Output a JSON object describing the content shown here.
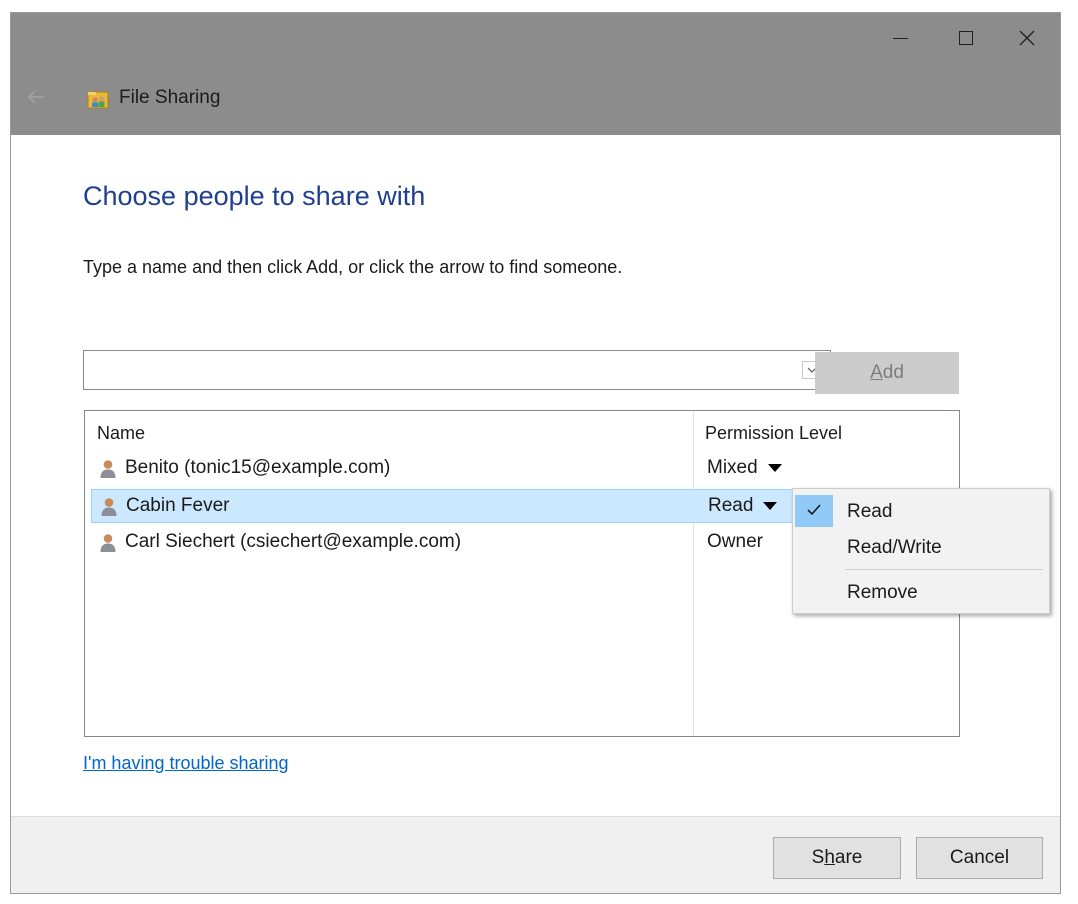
{
  "window": {
    "title": "File Sharing"
  },
  "dialog": {
    "heading": "Choose people to share with",
    "instruction": "Type a name and then click Add, or click the arrow to find someone.",
    "name_input": {
      "value": "",
      "placeholder": ""
    },
    "add_button": {
      "accel": "A",
      "rest": "dd"
    }
  },
  "list": {
    "headers": {
      "name": "Name",
      "permission": "Permission Level"
    },
    "rows": [
      {
        "name": "Benito (tonic15@example.com)",
        "permission": "Mixed",
        "has_dropdown": true
      },
      {
        "name": "Cabin Fever",
        "permission": "Read",
        "has_dropdown": true,
        "selected": true
      },
      {
        "name": "Carl Siechert (csiechert@example.com)",
        "permission": "Owner",
        "has_dropdown": false
      }
    ]
  },
  "permission_menu": {
    "items": [
      {
        "label": "Read",
        "checked": true
      },
      {
        "label": "Read/Write",
        "checked": false
      },
      {
        "label": "Remove",
        "checked": false
      }
    ]
  },
  "help_link": "I'm having trouble sharing",
  "footer": {
    "share_button": {
      "pre": "S",
      "accel": "h",
      "post": "are"
    },
    "cancel_button": "Cancel"
  },
  "colors": {
    "titlebar": "#8c8c8c",
    "heading": "#1f3f8f",
    "selection": "#cce8ff",
    "menu_check": "#91c9f7",
    "link": "#0066cc"
  }
}
